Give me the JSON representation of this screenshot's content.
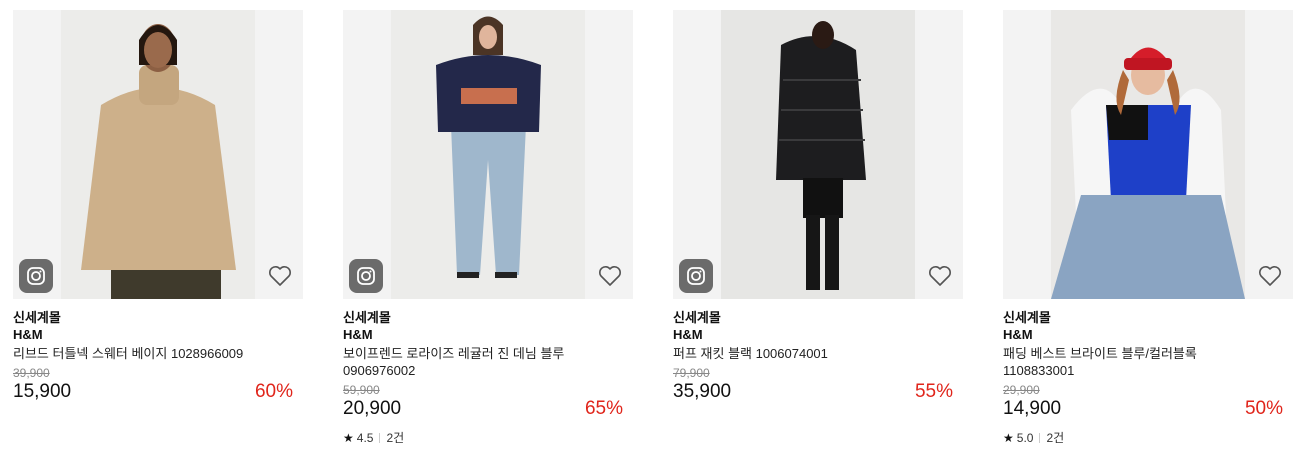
{
  "products": [
    {
      "tag": "신세계몰",
      "brand": "H&M",
      "name_lines": [
        "리브드 터틀넥 스웨터 베이지 1028966009"
      ],
      "original_price": "39,900",
      "price": "15,900",
      "discount": "60%",
      "has_camera_badge": true,
      "rating": null,
      "review_count": null
    },
    {
      "tag": "신세계몰",
      "brand": "H&M",
      "name_lines": [
        "보이프렌드 로라이즈 레귤러 진 데님 블루",
        "0906976002"
      ],
      "original_price": "59,900",
      "price": "20,900",
      "discount": "65%",
      "has_camera_badge": true,
      "rating": "4.5",
      "review_count": "2건"
    },
    {
      "tag": "신세계몰",
      "brand": "H&M",
      "name_lines": [
        "퍼프 재킷 블랙 1006074001"
      ],
      "original_price": "79,900",
      "price": "35,900",
      "discount": "55%",
      "has_camera_badge": true,
      "rating": null,
      "review_count": null
    },
    {
      "tag": "신세계몰",
      "brand": "H&M",
      "name_lines": [
        "패딩 베스트 브라이트 블루/컬러블록",
        "1108833001"
      ],
      "original_price": "29,900",
      "price": "14,900",
      "discount": "50%",
      "has_camera_badge": false,
      "rating": "5.0",
      "review_count": "2건"
    }
  ],
  "icons": {
    "camera": "camera-icon",
    "wishlist": "heart-outline-icon",
    "star": "star-icon"
  },
  "colors": {
    "discount": "#e0251b",
    "badge_bg": "#6b6b6b"
  }
}
